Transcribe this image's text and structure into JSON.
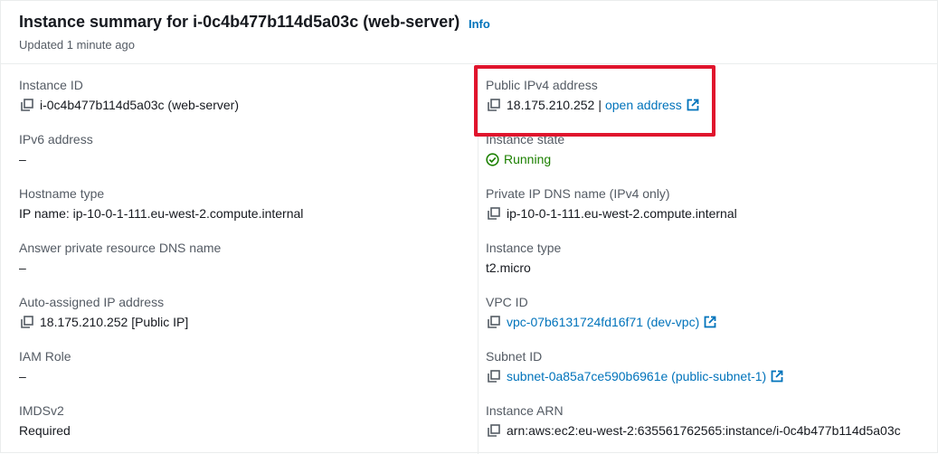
{
  "header": {
    "title": "Instance summary for i-0c4b477b114d5a03c (web-server)",
    "info_label": "Info",
    "updated": "Updated 1 minute ago"
  },
  "left": {
    "instance_id": {
      "label": "Instance ID",
      "value": "i-0c4b477b114d5a03c (web-server)"
    },
    "ipv6": {
      "label": "IPv6 address",
      "value": "–"
    },
    "hostname_type": {
      "label": "Hostname type",
      "value": "IP name: ip-10-0-1-111.eu-west-2.compute.internal"
    },
    "answer_dns": {
      "label": "Answer private resource DNS name",
      "value": "–"
    },
    "auto_ip": {
      "label": "Auto-assigned IP address",
      "value": "18.175.210.252 [Public IP]"
    },
    "iam_role": {
      "label": "IAM Role",
      "value": "–"
    },
    "imdsv2": {
      "label": "IMDSv2",
      "value": "Required"
    }
  },
  "right": {
    "public_ipv4": {
      "label": "Public IPv4 address",
      "value": "18.175.210.252",
      "separator": "|",
      "link": "open address"
    },
    "instance_state": {
      "label": "Instance state",
      "value": "Running"
    },
    "private_dns": {
      "label": "Private IP DNS name (IPv4 only)",
      "value": "ip-10-0-1-111.eu-west-2.compute.internal"
    },
    "instance_type": {
      "label": "Instance type",
      "value": "t2.micro"
    },
    "vpc_id": {
      "label": "VPC ID",
      "value": "vpc-07b6131724fd16f71 (dev-vpc)"
    },
    "subnet_id": {
      "label": "Subnet ID",
      "value": "subnet-0a85a7ce590b6961e (public-subnet-1)"
    },
    "instance_arn": {
      "label": "Instance ARN",
      "value": "arn:aws:ec2:eu-west-2:635561762565:instance/i-0c4b477b114d5a03c"
    }
  },
  "colors": {
    "link": "#0073bb",
    "running": "#1d8102",
    "highlight": "#e0152d",
    "label": "#545b64"
  },
  "icons": [
    "copy-icon",
    "external-link-icon",
    "check-circle-icon"
  ]
}
